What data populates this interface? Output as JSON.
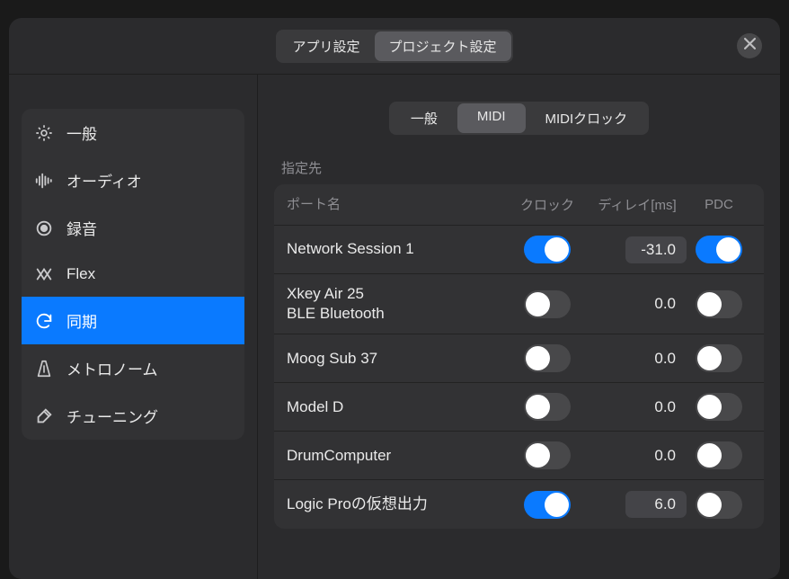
{
  "header": {
    "tabs": [
      {
        "id": "app",
        "label": "アプリ設定",
        "selected": false
      },
      {
        "id": "project",
        "label": "プロジェクト設定",
        "selected": true
      }
    ]
  },
  "sidebar": {
    "items": [
      {
        "id": "general",
        "label": "一般",
        "icon": "gear-icon",
        "selected": false
      },
      {
        "id": "audio",
        "label": "オーディオ",
        "icon": "waveform-icon",
        "selected": false
      },
      {
        "id": "record",
        "label": "録音",
        "icon": "record-icon",
        "selected": false
      },
      {
        "id": "flex",
        "label": "Flex",
        "icon": "flex-icon",
        "selected": false
      },
      {
        "id": "sync",
        "label": "同期",
        "icon": "sync-icon",
        "selected": true
      },
      {
        "id": "metronome",
        "label": "メトロノーム",
        "icon": "metronome-icon",
        "selected": false
      },
      {
        "id": "tuning",
        "label": "チューニング",
        "icon": "tuning-icon",
        "selected": false
      }
    ]
  },
  "content": {
    "subtabs": [
      {
        "id": "general",
        "label": "一般",
        "selected": false
      },
      {
        "id": "midi",
        "label": "MIDI",
        "selected": true
      },
      {
        "id": "midiclock",
        "label": "MIDIクロック",
        "selected": false
      }
    ],
    "section_label": "指定先",
    "columns": {
      "port": "ポート名",
      "clock": "クロック",
      "delay": "ディレイ[ms]",
      "pdc": "PDC"
    },
    "rows": [
      {
        "port": "Network Session 1",
        "clock_on": true,
        "delay": "-31.0",
        "delay_editable": true,
        "pdc_on": true
      },
      {
        "port": "Xkey Air 25\nBLE Bluetooth",
        "clock_on": false,
        "delay": "0.0",
        "delay_editable": false,
        "pdc_on": false
      },
      {
        "port": "Moog Sub 37",
        "clock_on": false,
        "delay": "0.0",
        "delay_editable": false,
        "pdc_on": false
      },
      {
        "port": "Model D",
        "clock_on": false,
        "delay": "0.0",
        "delay_editable": false,
        "pdc_on": false
      },
      {
        "port": "DrumComputer",
        "clock_on": false,
        "delay": "0.0",
        "delay_editable": false,
        "pdc_on": false
      },
      {
        "port": "Logic Proの仮想出力",
        "clock_on": true,
        "delay": "6.0",
        "delay_editable": true,
        "pdc_on": false
      }
    ]
  }
}
